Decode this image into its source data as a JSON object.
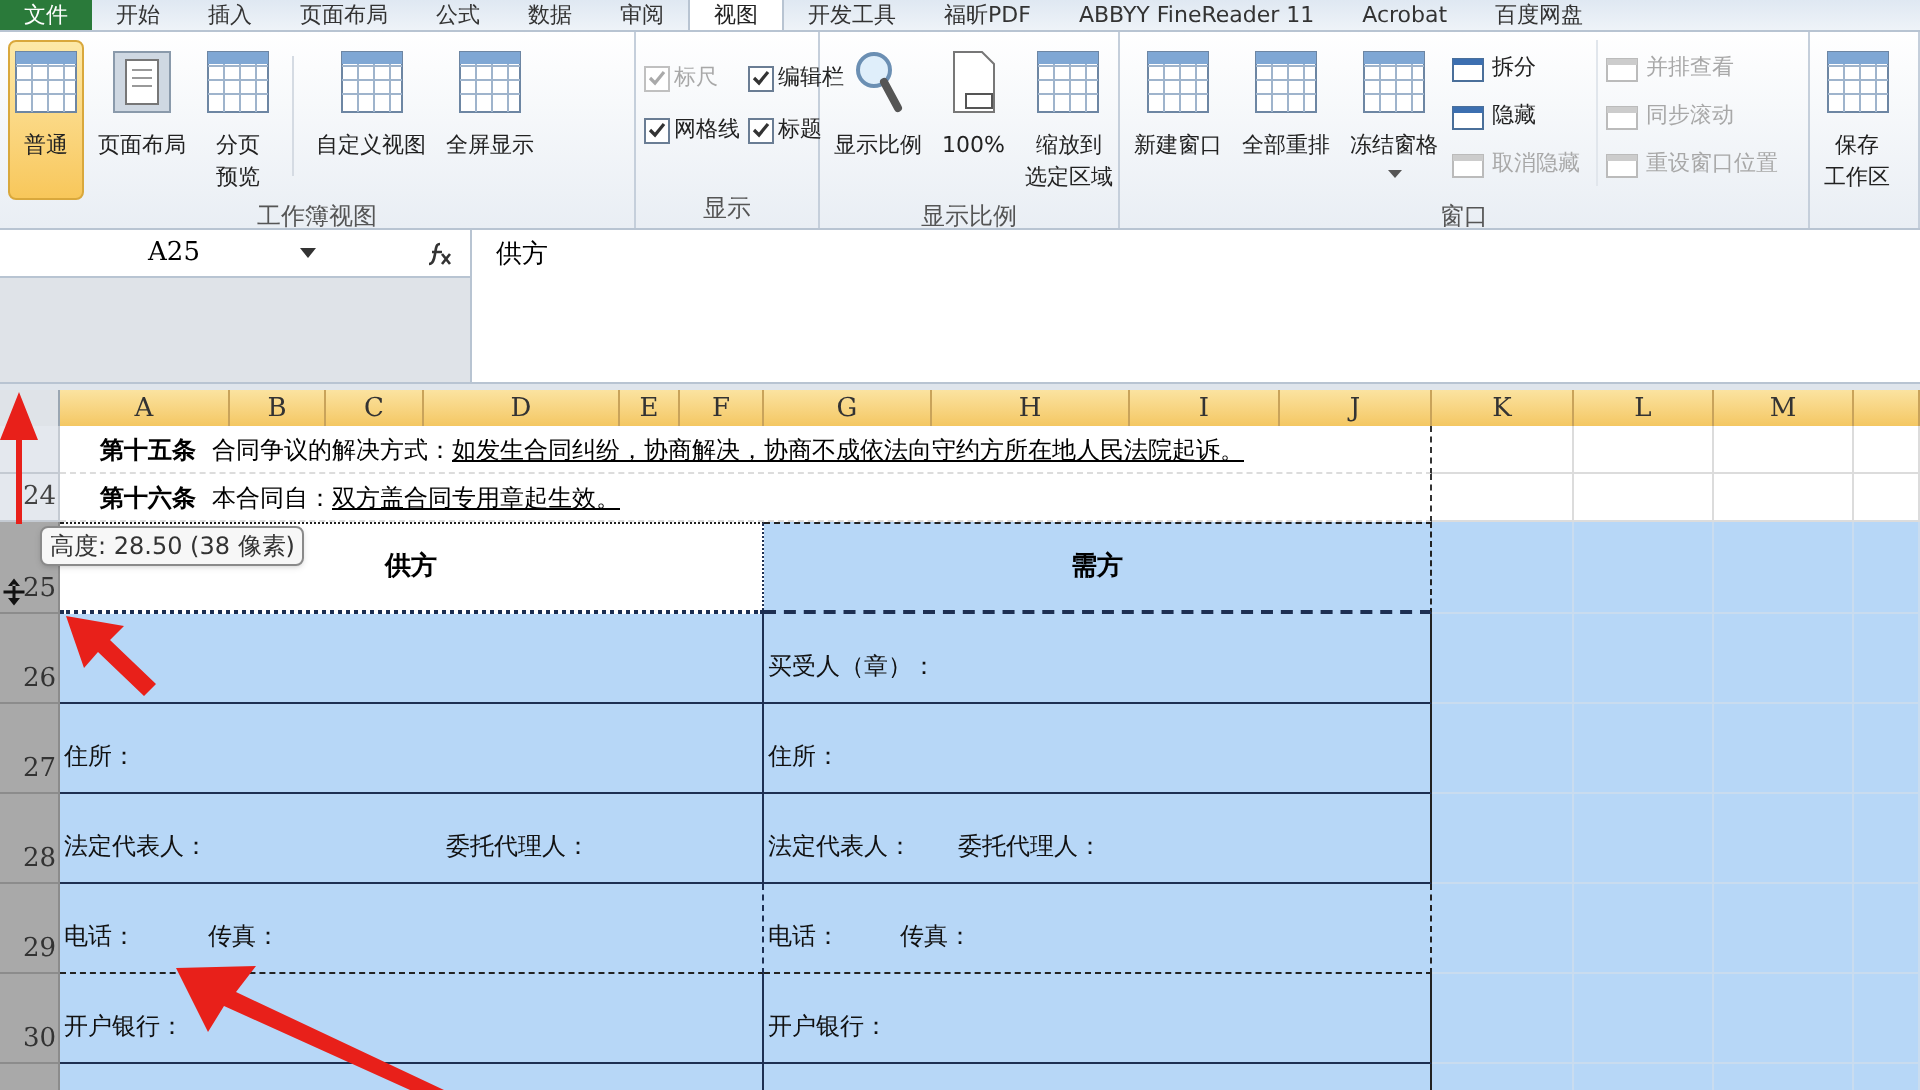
{
  "menu_tabs": [
    {
      "label": "文件",
      "kind": "file",
      "selected": false
    },
    {
      "label": "开始",
      "kind": "tab",
      "selected": false
    },
    {
      "label": "插入",
      "kind": "tab",
      "selected": false
    },
    {
      "label": "页面布局",
      "kind": "tab",
      "selected": false
    },
    {
      "label": "公式",
      "kind": "tab",
      "selected": false
    },
    {
      "label": "数据",
      "kind": "tab",
      "selected": false
    },
    {
      "label": "审阅",
      "kind": "tab",
      "selected": false
    },
    {
      "label": "视图",
      "kind": "tab",
      "selected": true
    },
    {
      "label": "开发工具",
      "kind": "tab",
      "selected": false
    },
    {
      "label": "福昕PDF",
      "kind": "tab",
      "selected": false
    },
    {
      "label": "ABBYY FineReader 11",
      "kind": "tab",
      "selected": false
    },
    {
      "label": "Acrobat",
      "kind": "tab",
      "selected": false
    },
    {
      "label": "百度网盘",
      "kind": "tab",
      "selected": false
    }
  ],
  "ribbon": {
    "groups": [
      {
        "title": "工作簿视图",
        "items": [
          {
            "kind": "big",
            "lines": [
              "普通"
            ],
            "selected": true
          },
          {
            "kind": "big",
            "lines": [
              "页面布局"
            ],
            "selected": false
          },
          {
            "kind": "big",
            "lines": [
              "分页",
              "预览"
            ],
            "selected": false
          },
          {
            "kind": "separator"
          },
          {
            "kind": "big",
            "lines": [
              "自定义视图"
            ],
            "selected": false
          },
          {
            "kind": "big",
            "lines": [
              "全屏显示"
            ],
            "selected": false
          }
        ]
      },
      {
        "title": "显示",
        "items": [
          {
            "kind": "checks",
            "checks": [
              {
                "label": "标尺",
                "checked": true,
                "disabled": true
              },
              {
                "label": "编辑栏",
                "checked": true,
                "disabled": false
              },
              {
                "label": "网格线",
                "checked": true,
                "disabled": false
              },
              {
                "label": "标题",
                "checked": true,
                "disabled": false
              }
            ]
          }
        ]
      },
      {
        "title": "显示比例",
        "items": [
          {
            "kind": "big",
            "lines": [
              "显示比例"
            ],
            "selected": false
          },
          {
            "kind": "big",
            "lines": [
              "100%"
            ],
            "selected": false
          },
          {
            "kind": "big",
            "lines": [
              "缩放到",
              "选定区域"
            ],
            "selected": false
          }
        ]
      },
      {
        "title": "窗口",
        "items": [
          {
            "kind": "big",
            "lines": [
              "新建窗口"
            ],
            "selected": false
          },
          {
            "kind": "big",
            "lines": [
              "全部重排"
            ],
            "selected": false
          },
          {
            "kind": "dropdown",
            "lines": [
              "冻结窗格"
            ],
            "selected": false
          },
          {
            "kind": "small",
            "entries": [
              {
                "label": "拆分",
                "disabled": false
              },
              {
                "label": "隐藏",
                "disabled": false
              },
              {
                "label": "取消隐藏",
                "disabled": true
              }
            ]
          },
          {
            "kind": "small",
            "entries": [
              {
                "label": "并排查看",
                "disabled": true
              },
              {
                "label": "同步滚动",
                "disabled": true
              },
              {
                "label": "重设窗口位置",
                "disabled": true
              }
            ]
          }
        ]
      },
      {
        "items": [
          {
            "kind": "big",
            "lines": [
              "保存",
              "工作区"
            ],
            "selected": false
          }
        ]
      }
    ]
  },
  "formula_bar": {
    "name_box": "A25",
    "value": "供方"
  },
  "sheet": {
    "columns": [
      {
        "label": "A",
        "selected": true
      },
      {
        "label": "B",
        "selected": true
      },
      {
        "label": "C",
        "selected": true
      },
      {
        "label": "D",
        "selected": true
      },
      {
        "label": "E",
        "selected": true
      },
      {
        "label": "F",
        "selected": true
      },
      {
        "label": "G",
        "selected": true
      },
      {
        "label": "H",
        "selected": true
      },
      {
        "label": "I",
        "selected": true
      },
      {
        "label": "J",
        "selected": true
      },
      {
        "label": "K",
        "selected": true
      },
      {
        "label": "L",
        "selected": true
      },
      {
        "label": "M",
        "selected": true
      },
      {
        "selected": true
      }
    ],
    "rows": [
      {
        "kind": "clause",
        "selected": false,
        "article": "第十五条",
        "subject": "合同争议的解决方式：",
        "text": "如发生合同纠纷，协商解决，协商不成依法向守约方所在地人民法院起诉。"
      },
      {
        "kind": "clause",
        "number": "24",
        "selected": false,
        "article": "第十六条",
        "subject": "本合同自：",
        "text": "双方盖合同专用章起生效。"
      },
      {
        "kind": "header",
        "number": "25",
        "selected": true,
        "left": "供方",
        "right": "需方"
      },
      {
        "kind": "form",
        "number": "26",
        "selected": true,
        "left": [],
        "right": [
          "买受人（章）："
        ]
      },
      {
        "kind": "form",
        "number": "27",
        "selected": true,
        "left": [
          "住所："
        ],
        "right": [
          "住所："
        ]
      },
      {
        "kind": "pair_wide",
        "number": "28",
        "selected": true,
        "left": [
          "法定代表人：",
          "委托代理人："
        ],
        "right": [
          "法定代表人：",
          "委托代理人："
        ]
      },
      {
        "kind": "pair_narrow",
        "number": "29",
        "selected": true,
        "left": [
          "电话：",
          "传真："
        ],
        "right": [
          "电话：",
          "传真："
        ]
      },
      {
        "kind": "form",
        "number": "30",
        "selected": true,
        "left": [
          "开户银行："
        ],
        "right": [
          "开户银行："
        ]
      },
      {
        "kind": "form",
        "selected": true,
        "left": [],
        "right": []
      }
    ]
  },
  "tooltip": "高度: 28.50 (38 像素)"
}
